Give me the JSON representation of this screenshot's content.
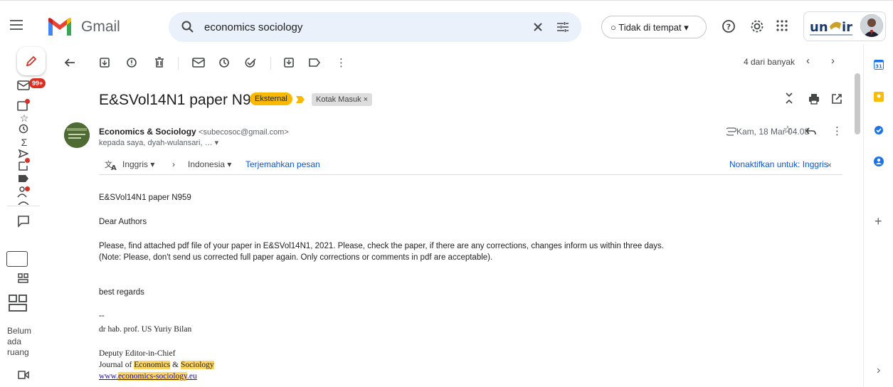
{
  "header": {
    "app_name": "Gmail",
    "search_value": "economics sociology",
    "status_label": "Tidak di tempat",
    "org_logo_text": "un ir"
  },
  "rail": {
    "unread_badge": "99+",
    "storage_text": [
      "Belum",
      "ada",
      "ruang"
    ]
  },
  "toolbar": {
    "counter": "4 dari banyak"
  },
  "email": {
    "subject": "E&SVol14N1 paper N959",
    "label_external": "Eksternal",
    "label_inbox": "Kotak Masuk",
    "sender_name": "Economics & Sociology",
    "sender_email": "<subecosoc@gmail.com>",
    "recipients": "kepada saya, dyah-wulansari, …",
    "date": "Kam, 18 Mar 04.08",
    "translate": {
      "from": "Inggris",
      "to": "Indonesia",
      "translate_link": "Terjemahkan pesan",
      "disable_link": "Nonaktifkan untuk: Inggris"
    },
    "body": {
      "line1": "E&SVol14N1 paper N959",
      "greeting": "Dear Authors",
      "para1": "Please, find attached pdf file of your paper in E&SVol14N1, 2021. Please, check the paper, if there are any corrections, changes inform us within three days.",
      "para2": "(Note: Please, don't send us corrected full paper again. Only corrections or comments in pdf are acceptable).",
      "regards": "best regards",
      "sig_dash": "--",
      "sig_name": "dr hab. prof. US Yuriy Bilan",
      "sig_title": "Deputy Editor-in-Chief",
      "sig_journal_prefix": "Journal of ",
      "sig_journal_econ": "Economics",
      "sig_journal_amp": " & ",
      "sig_journal_soc": "Sociology",
      "sig_url_prefix": "www.",
      "sig_url_highlight": "economics-sociology",
      "sig_url_suffix": ".eu"
    }
  },
  "colors": {
    "accent_blue": "#0b57d0",
    "label_yellow": "#f9b900",
    "badge_red": "#d93025",
    "highlight": "#fdd663"
  }
}
